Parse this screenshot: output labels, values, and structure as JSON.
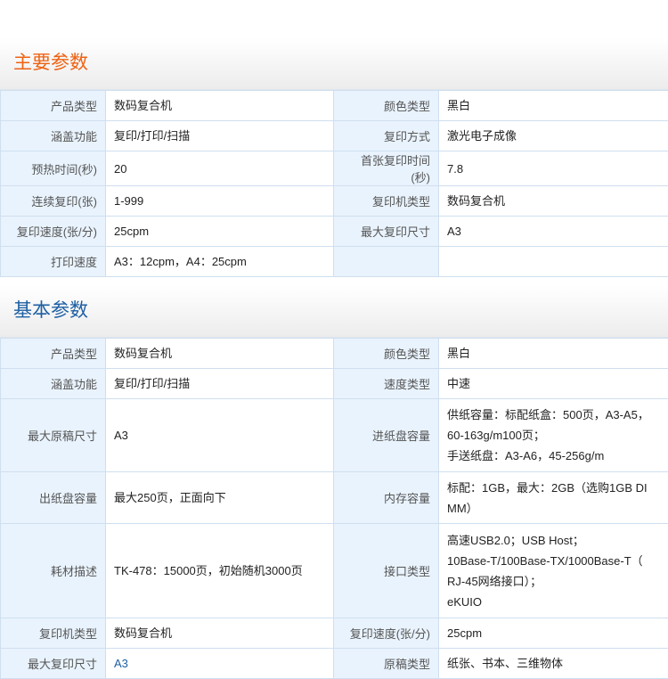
{
  "sections": [
    {
      "title": "主要参数",
      "rows": [
        {
          "l1": "产品类型",
          "v1": "数码复合机",
          "l2": "颜色类型",
          "v2": "黑白"
        },
        {
          "l1": "涵盖功能",
          "v1": "复印/打印/扫描",
          "l2": "复印方式",
          "v2": "激光电子成像"
        },
        {
          "l1": "预热时间(秒)",
          "v1": "20",
          "l2": "首张复印时间(秒)",
          "v2": "7.8"
        },
        {
          "l1": "连续复印(张)",
          "v1": "1-999",
          "l2": "复印机类型",
          "v2": "数码复合机"
        },
        {
          "l1": "复印速度(张/分)",
          "v1": "25cpm",
          "l2": "最大复印尺寸",
          "v2": "A3"
        },
        {
          "l1": "打印速度",
          "v1": "A3：12cpm，A4：25cpm",
          "l2": "",
          "v2": ""
        }
      ]
    },
    {
      "title": "基本参数",
      "rows": [
        {
          "l1": "产品类型",
          "v1": "数码复合机",
          "l2": "颜色类型",
          "v2": "黑白"
        },
        {
          "l1": "涵盖功能",
          "v1": "复印/打印/扫描",
          "l2": "速度类型",
          "v2": "中速"
        },
        {
          "l1": "最大原稿尺寸",
          "v1": "A3",
          "l2": "进纸盘容量",
          "v2": "供纸容量：标配纸盒：500页，A3-A5，\n60-163g/m100页；\n手送纸盘：A3-A6，45-256g/m"
        },
        {
          "l1": "出纸盘容量",
          "v1": "最大250页，正面向下",
          "l2": "内存容量",
          "v2": "标配：1GB，最大：2GB（选购1GB DI\nMM）"
        },
        {
          "l1": "耗材描述",
          "v1": "TK-478：15000页，初始随机3000页",
          "l2": "接口类型",
          "v2": "高速USB2.0；USB Host；\n10Base-T/100Base-TX/1000Base-T（\nRJ-45网络接口）；\neKUIO"
        },
        {
          "l1": "复印机类型",
          "v1": "数码复合机",
          "l2": "复印速度(张/分)",
          "v2": "25cpm"
        },
        {
          "l1": "最大复印尺寸",
          "v1": "A3",
          "l2": "原稿类型",
          "v2": "纸张、书本、三维物体"
        }
      ]
    }
  ],
  "colors": {
    "title_main": "#ee6212",
    "title_basic": "#1e5fa3",
    "label_bg": "#e9f3fd",
    "border": "#cfdfef"
  }
}
